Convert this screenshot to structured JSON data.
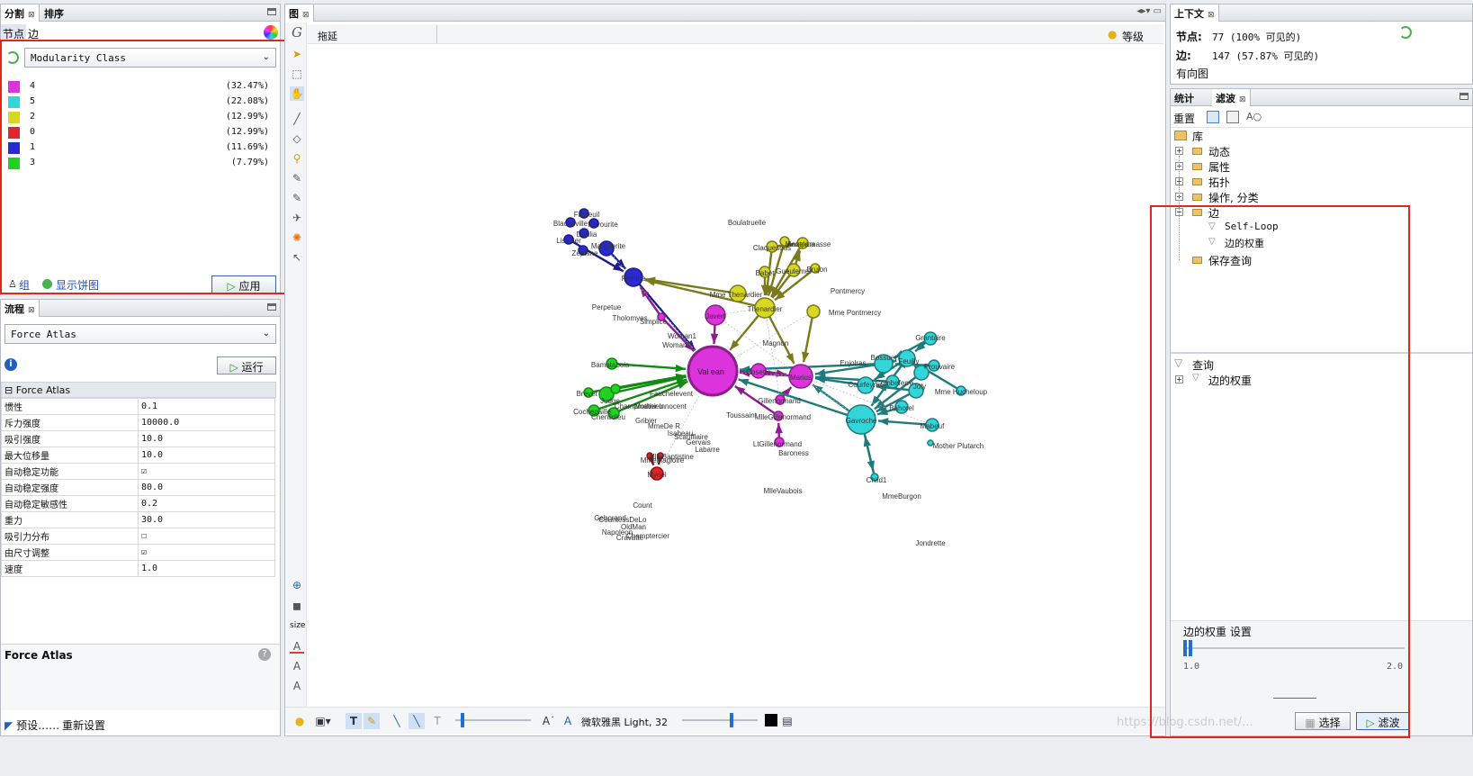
{
  "partition": {
    "tab_partition": "分割",
    "tab_ranking": "排序",
    "subtab_nodes": "节点",
    "subtab_edges": "边",
    "attribute": "Modularity Class",
    "legend": [
      {
        "label": "4",
        "pct": "(32.47%)",
        "color": "#dd33dd"
      },
      {
        "label": "5",
        "pct": "(22.08%)",
        "color": "#33d6d8"
      },
      {
        "label": "2",
        "pct": "(12.99%)",
        "color": "#d8d822"
      },
      {
        "label": "0",
        "pct": "(12.99%)",
        "color": "#e0262a"
      },
      {
        "label": "1",
        "pct": "(11.69%)",
        "color": "#2a2acf"
      },
      {
        "label": "3",
        "pct": "(7.79%)",
        "color": "#22d222"
      }
    ],
    "group_label": "组",
    "pie_label": "显示饼图",
    "apply_label": "应用"
  },
  "layout": {
    "tab": "流程",
    "algorithm": "Force Atlas",
    "run_label": "运行",
    "section": "Force Atlas",
    "properties": [
      {
        "name": "惯性",
        "value": "0.1"
      },
      {
        "name": "斥力强度",
        "value": "10000.0"
      },
      {
        "name": "吸引强度",
        "value": "10.0"
      },
      {
        "name": "最大位移量",
        "value": "10.0"
      },
      {
        "name": "自动稳定功能",
        "value": "☑"
      },
      {
        "name": "自动稳定强度",
        "value": "80.0"
      },
      {
        "name": "自动稳定敏感性",
        "value": "0.2"
      },
      {
        "name": "重力",
        "value": "30.0"
      },
      {
        "name": "吸引力分布",
        "value": "☐"
      },
      {
        "name": "由尺寸调整",
        "value": "☑"
      },
      {
        "name": "速度",
        "value": "1.0"
      }
    ],
    "desc_title": "Force Atlas",
    "presets_label": "预设……",
    "reset_label": "重新设置"
  },
  "graph": {
    "tab": "图",
    "drag_label": "拖延",
    "level_label": "等级",
    "font_label": "微软雅黑 Light, 32",
    "size_label": "size",
    "labels": [
      {
        "id": "valjean",
        "text": "Val ean",
        "color": "#dd33dd"
      },
      {
        "id": "boulatruelle",
        "text": "Boulatruelle"
      },
      {
        "id": "anzelma",
        "text": "Anzelma"
      },
      {
        "id": "brujon",
        "text": "Brujon"
      },
      {
        "id": "mme-thenardier",
        "text": "Mme Thenardier"
      },
      {
        "id": "thenardier",
        "text": "Thenardier"
      },
      {
        "id": "babet",
        "text": "Babet"
      },
      {
        "id": "gueulemer",
        "text": "Gueulemer"
      },
      {
        "id": "montparnasse",
        "text": "Montparnasse"
      },
      {
        "id": "claquesous",
        "text": "Claquesous"
      },
      {
        "id": "pontmercy",
        "text": "Pontmercy"
      },
      {
        "id": "mme-pontmercy",
        "text": "Mme Pontmercy"
      },
      {
        "id": "javert",
        "text": "Javert"
      },
      {
        "id": "fantine",
        "text": "Fantine"
      },
      {
        "id": "simplice",
        "text": "Simplice"
      },
      {
        "id": "marius",
        "text": "Marius"
      },
      {
        "id": "cosette",
        "text": "Cosette"
      },
      {
        "id": "magnon",
        "text": "Magnon"
      },
      {
        "id": "gillenormand",
        "text": "Gillenormand"
      },
      {
        "id": "mlle-gillenormand",
        "text": "MlleGillenormand"
      },
      {
        "id": "lt-gillenormand",
        "text": "LtGillenormand"
      },
      {
        "id": "baroness",
        "text": "Baroness"
      },
      {
        "id": "toussaint",
        "text": "Toussaint"
      },
      {
        "id": "mlle-vaubois",
        "text": "MlleVaubois"
      },
      {
        "id": "bamatabois",
        "text": "Bamatabois"
      },
      {
        "id": "champmathieu",
        "text": "Champmathieu"
      },
      {
        "id": "cochepaille",
        "text": "Cochepaille"
      },
      {
        "id": "chenildieu",
        "text": "Chenildieu"
      },
      {
        "id": "brevet",
        "text": "Brevet"
      },
      {
        "id": "judge",
        "text": "Judge"
      },
      {
        "id": "gribier",
        "text": "Gribier"
      },
      {
        "id": "mme-de-r",
        "text": "MmeDe R"
      },
      {
        "id": "isabeau",
        "text": "Isabeau"
      },
      {
        "id": "gervais",
        "text": "Gervais"
      },
      {
        "id": "labarre",
        "text": "Labarre"
      },
      {
        "id": "scaufflaire",
        "text": "Scaufflaire"
      },
      {
        "id": "woman1",
        "text": "Woman1"
      },
      {
        "id": "woman2",
        "text": "Woman2"
      },
      {
        "id": "fauchelevent",
        "text": "Fauchelevent"
      },
      {
        "id": "mother-innocent",
        "text": "Mother Innocent"
      },
      {
        "id": "myriel",
        "text": "Myriel"
      },
      {
        "id": "mlle-baptistine",
        "text": "MlleBaptistine"
      },
      {
        "id": "mme-magloire",
        "text": "MmeMagloire"
      },
      {
        "id": "count",
        "text": "Count"
      },
      {
        "id": "geborand",
        "text": "Geborand"
      },
      {
        "id": "champtercier",
        "text": "Champtercier"
      },
      {
        "id": "cravatte",
        "text": "Cravatte"
      },
      {
        "id": "oldman",
        "text": "OldMan"
      },
      {
        "id": "napoleon",
        "text": "Napoleon"
      },
      {
        "id": "countess-de-lo",
        "text": "CountessDeLo"
      },
      {
        "id": "tholomyes",
        "text": "Tholomyes"
      },
      {
        "id": "listolier",
        "text": "Listolier"
      },
      {
        "id": "fameuil",
        "text": "Fameuil"
      },
      {
        "id": "blacheville",
        "text": "Blacheville"
      },
      {
        "id": "favourite",
        "text": "Favourite"
      },
      {
        "id": "dahlia",
        "text": "Dahlia"
      },
      {
        "id": "zephine",
        "text": "Zephine"
      },
      {
        "id": "perpetue",
        "text": "Perpetue"
      },
      {
        "id": "marguerite",
        "text": "Marguerite"
      },
      {
        "id": "gavroche",
        "text": "Gavroche"
      },
      {
        "id": "enjolras",
        "text": "Enjolras"
      },
      {
        "id": "courfeyrac",
        "text": "Courfeyrac"
      },
      {
        "id": "combeferre",
        "text": "Combeferre"
      },
      {
        "id": "bossuet",
        "text": "Bossuet"
      },
      {
        "id": "feuilly",
        "text": "Feuilly"
      },
      {
        "id": "joly",
        "text": "Joly"
      },
      {
        "id": "grantaire",
        "text": "Grantaire"
      },
      {
        "id": "prouvaire",
        "text": "Prouvaire"
      },
      {
        "id": "bahorel",
        "text": "Bahorel"
      },
      {
        "id": "mabeuf",
        "text": "Mabeuf"
      },
      {
        "id": "mme-hucheloup",
        "text": "Mme Hucheloup"
      },
      {
        "id": "mother-plutarch",
        "text": "Mother Plutarch"
      },
      {
        "id": "child1",
        "text": "Child1"
      },
      {
        "id": "mme-burgon",
        "text": "MmeBurgon"
      },
      {
        "id": "jondrette",
        "text": "Jondrette"
      }
    ]
  },
  "context": {
    "tab": "上下文",
    "nodes_label": "节点:",
    "nodes_value": "77 (100% 可见的)",
    "edges_label": "边:",
    "edges_value": "147 (57.87% 可见的)",
    "graph_type": "有向图"
  },
  "filters": {
    "tab_stats": "统计",
    "tab_filters": "滤波",
    "reset_label": "重置",
    "library": "库",
    "categories": [
      "动态",
      "属性",
      "拓扑",
      "操作, 分类",
      "边"
    ],
    "edge_children": [
      "Self-Loop",
      "边的权重"
    ],
    "saved": "保存查询",
    "queries": "查询",
    "query_item": "边的权重",
    "settings_title": "边的权重 设置",
    "range_min": "1.0",
    "range_max": "2.0",
    "select_label": "选择",
    "filter_label": "滤波",
    "watermark": "https://blog.csdn.net/..."
  }
}
